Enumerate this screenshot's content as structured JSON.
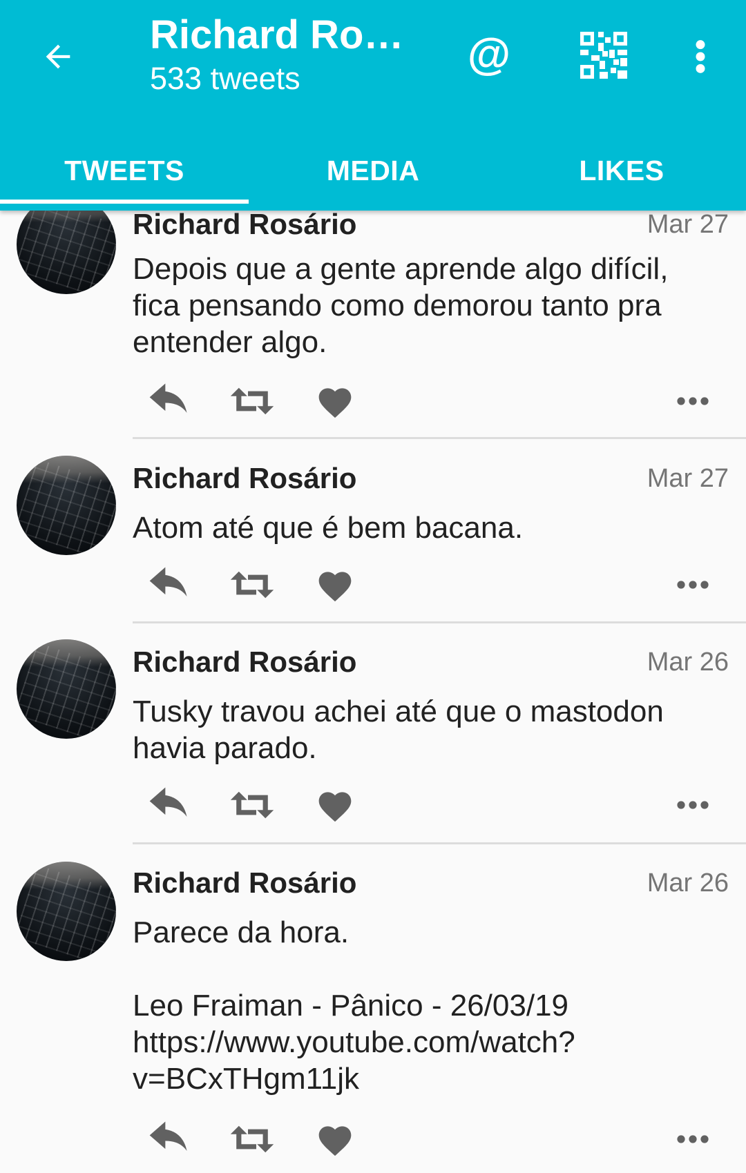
{
  "toolbar": {
    "title": "Richard Ros…",
    "subtitle": "533 tweets",
    "back_icon": "arrow-back-icon",
    "mention_icon": "at-sign-icon",
    "mention_label": "@",
    "qr_icon": "qr-code-icon",
    "menu_icon": "more-vert-icon"
  },
  "tabs": [
    {
      "label": "TWEETS",
      "active": true
    },
    {
      "label": "MEDIA",
      "active": false
    },
    {
      "label": "LIKES",
      "active": false
    }
  ],
  "statuses": [
    {
      "name": "Richard Rosário",
      "date": "Mar 27",
      "content": "Depois que a gente aprende algo difícil, fica pensando como demorou tanto pra entender algo."
    },
    {
      "name": "Richard Rosário",
      "date": "Mar 27",
      "content": "Atom até que é bem bacana."
    },
    {
      "name": "Richard Rosário",
      "date": "Mar 26",
      "content": "Tusky travou achei até que o mastodon havia parado."
    },
    {
      "name": "Richard Rosário",
      "date": "Mar 26",
      "content": "Parece da hora.\n\nLeo Fraiman - Pânico - 26/03/19\nhttps://www.youtube.com/watch?\nv=BCxTHgm11jk"
    }
  ],
  "colors": {
    "primary": "#00bcd4",
    "icon_gray": "#616161",
    "text": "#212121",
    "secondary_text": "#757575"
  },
  "action_icons": [
    "reply-icon",
    "boost-icon",
    "favourite-icon",
    "more-horiz-icon"
  ]
}
